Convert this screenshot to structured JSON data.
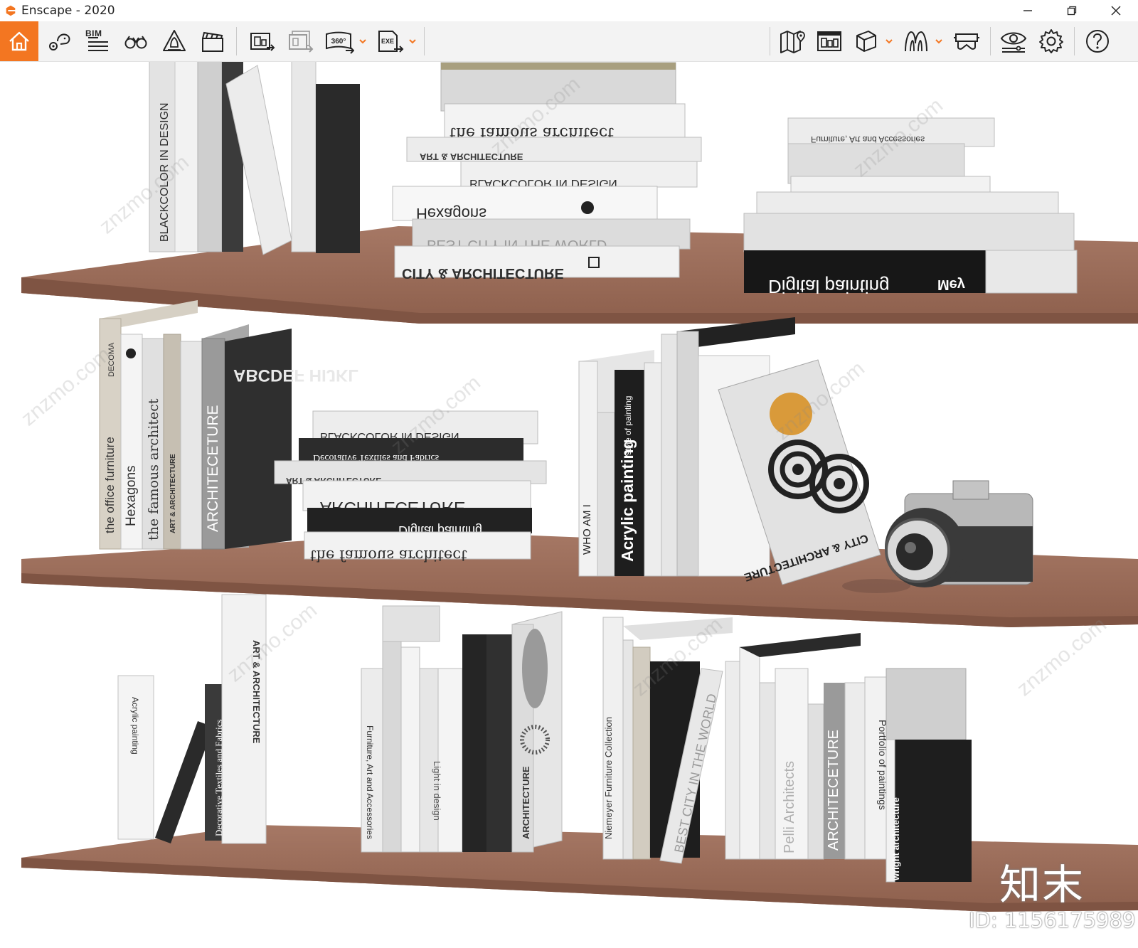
{
  "window": {
    "title": "Enscape - 2020",
    "controls": [
      "minimize",
      "restore",
      "close"
    ]
  },
  "toolbar": {
    "bim_label": "BIM",
    "accent_color": "#f37621",
    "left_icons": [
      "home-icon",
      "views-icon",
      "bim-icon",
      "binoculars-icon",
      "atmosphere-icon",
      "video-icon"
    ],
    "export_icons": [
      "screenshot-export-icon",
      "batch-export-icon",
      "panorama-export-icon",
      "exe-export-icon"
    ],
    "panorama_label": "360°",
    "exe_label": "EXE",
    "right_icons": [
      "map-icon",
      "gallery-icon",
      "asset-library-icon",
      "material-icon",
      "vr-headset-icon",
      "visual-settings-icon",
      "settings-icon",
      "help-icon"
    ]
  },
  "scene": {
    "watermark_text": "znzmo.com",
    "shelf_color": "#9c6e5a",
    "top_shelf_books": [
      "BLACKCOLOR IN DESIGN",
      "the famous architect",
      "ART & ARCHITECTURE",
      "BLACKCOLOR IN DESIGN",
      "Hexagons",
      "BEST CITY IN THE WORLD",
      "CITY & ARCHITECTURE",
      "Furniture, Art and Accessories",
      "Digital painting",
      "Mey"
    ],
    "middle_shelf_books": [
      "the office furniture",
      "DECOMA",
      "Hexagons",
      "the famous architect",
      "ART & ARCHITECTURE",
      "ARCHITECETURE",
      "ABCDEF HIJKL",
      "BLACKCOLOR IN DESIGN",
      "Decorative Textiles and Fabrics",
      "ART & ARCHITECTURE",
      "ARCHITECETURE",
      "Digital painting",
      "the famous architect",
      "WHO AM I",
      "Acrylic painting",
      "style of painting",
      "CITY & ARCHITECTURE"
    ],
    "bottom_shelf_books": [
      "Acrylic painting",
      "Decorative Textiles and Fabrics",
      "ART & ARCHITECTURE",
      "Furniture, Art and Accessories",
      "Light in design",
      "ARCHITECTURE",
      "Niemeyer Furniture Collection",
      "BEST CITY IN THE WORLD",
      "Pelli Architects",
      "ARCHITECETURE",
      "Portfolio of paintings",
      "wright architecture"
    ],
    "brand_mark": "知末",
    "id_label": "ID: 1156175989"
  }
}
